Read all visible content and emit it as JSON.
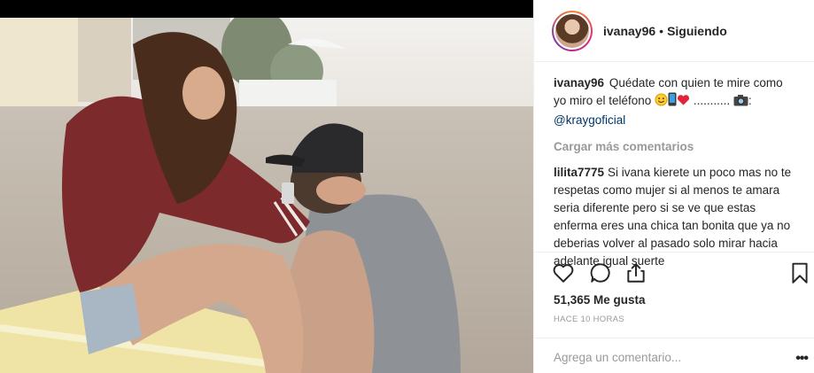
{
  "post": {
    "username": "ivanay96",
    "separator": "•",
    "follow_status": "Siguiendo",
    "caption_text": "Quédate con quien te mire como yo miro el teléfono",
    "caption_dots": " ........... ",
    "caption_suffix": ":",
    "caption_mention": "@kraygoficial",
    "load_more": "Cargar más comentarios",
    "likes": "51,365 Me gusta",
    "time_ago": "HACE 10 HORAS",
    "add_comment_placeholder": "Agrega un comentario...",
    "more_options": "•••"
  },
  "comments": [
    {
      "username": "lilita7775",
      "text": "Si ivana kierete un poco mas no te respetas como mujer si al menos te amara seria diferente pero si se ve que estas enferma eres una chica tan bonita que ya no deberias volver al pasado solo mirar hacia adelante igual suerte"
    }
  ],
  "icons": {
    "like": "heart-icon",
    "comment": "comment-bubble-icon",
    "share": "share-icon",
    "save": "bookmark-icon",
    "caption_emojis": [
      "smiling-face-icon",
      "mobile-phone-icon",
      "red-heart-icon"
    ],
    "camera": "camera-icon"
  },
  "colors": {
    "mention": "#003569",
    "muted": "#999999",
    "text": "#262626",
    "divider": "#efefef"
  }
}
